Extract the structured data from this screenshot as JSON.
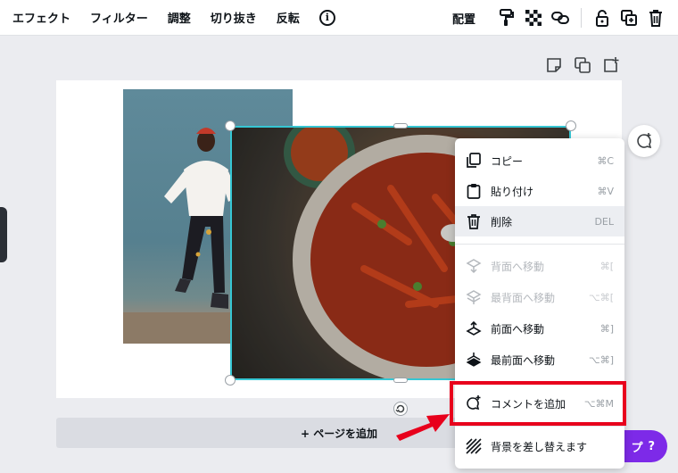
{
  "toolbar": {
    "left_items": [
      {
        "label": "エフェクト"
      },
      {
        "label": "フィルター"
      },
      {
        "label": "調整"
      },
      {
        "label": "切り抜き"
      },
      {
        "label": "反転"
      }
    ],
    "info_glyph": "i",
    "arrange_label": "配置",
    "right_icons": [
      "paint-roller-icon",
      "transparency-icon",
      "link-icon",
      "lock-icon",
      "duplicate-icon",
      "trash-icon"
    ]
  },
  "page": {
    "action_icons": [
      "note-icon",
      "copy-page-icon",
      "add-page-icon"
    ],
    "add_page_label": "+ ページを追加"
  },
  "help": {
    "label": "プ",
    "glyph": "?",
    "color": "#7d2ae8"
  },
  "selection": {
    "color": "#36c6d3"
  },
  "context_menu": {
    "items": [
      {
        "label": "コピー",
        "shortcut": "⌘C",
        "icon": "copy-icon",
        "enabled": true
      },
      {
        "label": "貼り付け",
        "shortcut": "⌘V",
        "icon": "clipboard-icon",
        "enabled": true
      },
      {
        "label": "削除",
        "shortcut": "DEL",
        "icon": "trash-icon",
        "enabled": true,
        "highlighted": true
      },
      {
        "label": "背面へ移動",
        "shortcut": "⌘[",
        "icon": "send-backward-icon",
        "enabled": false
      },
      {
        "label": "最背面へ移動",
        "shortcut": "⌥⌘[",
        "icon": "send-to-back-icon",
        "enabled": false
      },
      {
        "label": "前面へ移動",
        "shortcut": "⌘]",
        "icon": "bring-forward-icon",
        "enabled": true
      },
      {
        "label": "最前面へ移動",
        "shortcut": "⌥⌘]",
        "icon": "bring-to-front-icon",
        "enabled": true
      },
      {
        "label": "コメントを追加",
        "shortcut": "⌥⌘M",
        "icon": "add-comment-icon",
        "enabled": true
      },
      {
        "label": "背景を差し替えます",
        "shortcut": "",
        "icon": "replace-background-icon",
        "enabled": true
      }
    ]
  },
  "annotation": {
    "highlight_color": "#e8001c"
  }
}
